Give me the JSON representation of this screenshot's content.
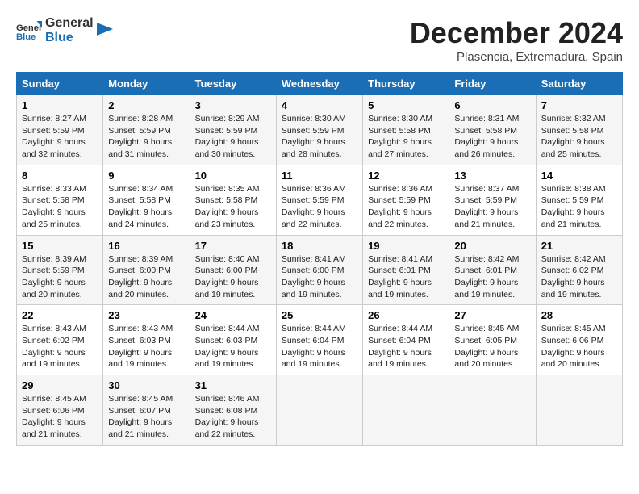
{
  "header": {
    "logo_line1": "General",
    "logo_line2": "Blue",
    "month_title": "December 2024",
    "location": "Plasencia, Extremadura, Spain"
  },
  "weekdays": [
    "Sunday",
    "Monday",
    "Tuesday",
    "Wednesday",
    "Thursday",
    "Friday",
    "Saturday"
  ],
  "weeks": [
    [
      {
        "day": "1",
        "sunrise": "8:27 AM",
        "sunset": "5:59 PM",
        "daylight": "9 hours and 32 minutes."
      },
      {
        "day": "2",
        "sunrise": "8:28 AM",
        "sunset": "5:59 PM",
        "daylight": "9 hours and 31 minutes."
      },
      {
        "day": "3",
        "sunrise": "8:29 AM",
        "sunset": "5:59 PM",
        "daylight": "9 hours and 30 minutes."
      },
      {
        "day": "4",
        "sunrise": "8:30 AM",
        "sunset": "5:59 PM",
        "daylight": "9 hours and 28 minutes."
      },
      {
        "day": "5",
        "sunrise": "8:30 AM",
        "sunset": "5:58 PM",
        "daylight": "9 hours and 27 minutes."
      },
      {
        "day": "6",
        "sunrise": "8:31 AM",
        "sunset": "5:58 PM",
        "daylight": "9 hours and 26 minutes."
      },
      {
        "day": "7",
        "sunrise": "8:32 AM",
        "sunset": "5:58 PM",
        "daylight": "9 hours and 25 minutes."
      }
    ],
    [
      {
        "day": "8",
        "sunrise": "8:33 AM",
        "sunset": "5:58 PM",
        "daylight": "9 hours and 25 minutes."
      },
      {
        "day": "9",
        "sunrise": "8:34 AM",
        "sunset": "5:58 PM",
        "daylight": "9 hours and 24 minutes."
      },
      {
        "day": "10",
        "sunrise": "8:35 AM",
        "sunset": "5:58 PM",
        "daylight": "9 hours and 23 minutes."
      },
      {
        "day": "11",
        "sunrise": "8:36 AM",
        "sunset": "5:59 PM",
        "daylight": "9 hours and 22 minutes."
      },
      {
        "day": "12",
        "sunrise": "8:36 AM",
        "sunset": "5:59 PM",
        "daylight": "9 hours and 22 minutes."
      },
      {
        "day": "13",
        "sunrise": "8:37 AM",
        "sunset": "5:59 PM",
        "daylight": "9 hours and 21 minutes."
      },
      {
        "day": "14",
        "sunrise": "8:38 AM",
        "sunset": "5:59 PM",
        "daylight": "9 hours and 21 minutes."
      }
    ],
    [
      {
        "day": "15",
        "sunrise": "8:39 AM",
        "sunset": "5:59 PM",
        "daylight": "9 hours and 20 minutes."
      },
      {
        "day": "16",
        "sunrise": "8:39 AM",
        "sunset": "6:00 PM",
        "daylight": "9 hours and 20 minutes."
      },
      {
        "day": "17",
        "sunrise": "8:40 AM",
        "sunset": "6:00 PM",
        "daylight": "9 hours and 19 minutes."
      },
      {
        "day": "18",
        "sunrise": "8:41 AM",
        "sunset": "6:00 PM",
        "daylight": "9 hours and 19 minutes."
      },
      {
        "day": "19",
        "sunrise": "8:41 AM",
        "sunset": "6:01 PM",
        "daylight": "9 hours and 19 minutes."
      },
      {
        "day": "20",
        "sunrise": "8:42 AM",
        "sunset": "6:01 PM",
        "daylight": "9 hours and 19 minutes."
      },
      {
        "day": "21",
        "sunrise": "8:42 AM",
        "sunset": "6:02 PM",
        "daylight": "9 hours and 19 minutes."
      }
    ],
    [
      {
        "day": "22",
        "sunrise": "8:43 AM",
        "sunset": "6:02 PM",
        "daylight": "9 hours and 19 minutes."
      },
      {
        "day": "23",
        "sunrise": "8:43 AM",
        "sunset": "6:03 PM",
        "daylight": "9 hours and 19 minutes."
      },
      {
        "day": "24",
        "sunrise": "8:44 AM",
        "sunset": "6:03 PM",
        "daylight": "9 hours and 19 minutes."
      },
      {
        "day": "25",
        "sunrise": "8:44 AM",
        "sunset": "6:04 PM",
        "daylight": "9 hours and 19 minutes."
      },
      {
        "day": "26",
        "sunrise": "8:44 AM",
        "sunset": "6:04 PM",
        "daylight": "9 hours and 19 minutes."
      },
      {
        "day": "27",
        "sunrise": "8:45 AM",
        "sunset": "6:05 PM",
        "daylight": "9 hours and 20 minutes."
      },
      {
        "day": "28",
        "sunrise": "8:45 AM",
        "sunset": "6:06 PM",
        "daylight": "9 hours and 20 minutes."
      }
    ],
    [
      {
        "day": "29",
        "sunrise": "8:45 AM",
        "sunset": "6:06 PM",
        "daylight": "9 hours and 21 minutes."
      },
      {
        "day": "30",
        "sunrise": "8:45 AM",
        "sunset": "6:07 PM",
        "daylight": "9 hours and 21 minutes."
      },
      {
        "day": "31",
        "sunrise": "8:46 AM",
        "sunset": "6:08 PM",
        "daylight": "9 hours and 22 minutes."
      },
      null,
      null,
      null,
      null
    ]
  ]
}
